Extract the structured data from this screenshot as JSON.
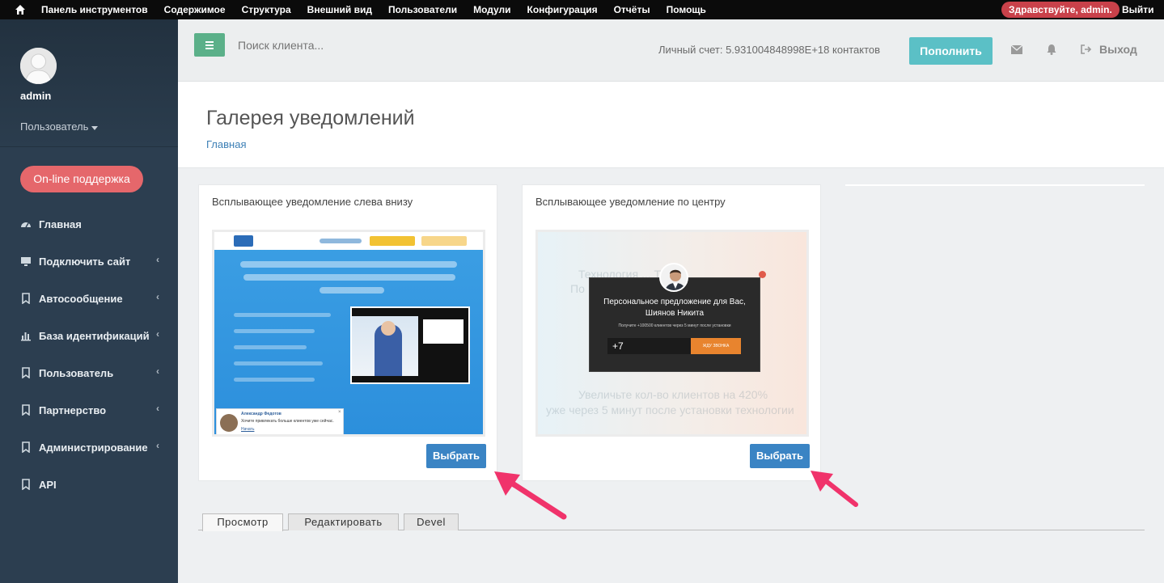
{
  "adminbar": {
    "menu": [
      "Панель инструментов",
      "Содержимое",
      "Структура",
      "Внешний вид",
      "Пользователи",
      "Модули",
      "Конфигурация",
      "Отчёты",
      "Помощь"
    ],
    "greeting": "Здравствуйте, admin.",
    "logout": "Выйти",
    "greeting_color": "#c9414a"
  },
  "sidebar": {
    "username": "admin",
    "role": "Пользователь",
    "support_button": "On-line поддержка",
    "items": [
      {
        "label": "Главная",
        "icon": "dashboard-icon",
        "has_submenu": false
      },
      {
        "label": "Подключить сайт",
        "icon": "monitor-icon",
        "has_submenu": true
      },
      {
        "label": "Автосообщение",
        "icon": "bookmark-icon",
        "has_submenu": true
      },
      {
        "label": "База идентификаций",
        "icon": "bar-chart-icon",
        "has_submenu": true
      },
      {
        "label": "Пользователь",
        "icon": "bookmark-icon",
        "has_submenu": true
      },
      {
        "label": "Партнерство",
        "icon": "bookmark-icon",
        "has_submenu": true
      },
      {
        "label": "Администрирование",
        "icon": "bookmark-icon",
        "has_submenu": true
      },
      {
        "label": "API",
        "icon": "bookmark-icon",
        "has_submenu": false
      }
    ],
    "bg_color": "#2c3e50",
    "support_color": "#e5676b"
  },
  "header": {
    "search_placeholder": "Поиск клиента...",
    "account_text": "Личный счет: 5.931004848998E+18 контактов",
    "topup_button": "Пополнить",
    "logout_button": "Выход",
    "menu_button_color": "#5bb089",
    "topup_color": "#5bc0c6"
  },
  "page": {
    "title": "Галерея уведомлений",
    "breadcrumb": "Главная"
  },
  "cards": [
    {
      "title": "Всплывающее уведомление слева внизу",
      "select_button": "Выбрать",
      "preview": {
        "notice_name": "Александр Федотов",
        "notice_message": "Хочите привлекать больше клиентов уже сейчас.",
        "notice_link": "Начать"
      }
    },
    {
      "title": "Всплывающее уведомление по центру",
      "select_button": "Выбрать",
      "preview": {
        "offer_line1": "Персональное предложение для Вас,",
        "offer_line2": "Шиянов Никита",
        "fine_print": "Получите +100500 клиентов через 5 минут после установки",
        "phone_value": "+7",
        "call_button": "ЖДУ ЗВОНКА",
        "bg_text_1": "Увеличьте кол-во клиентов на 420%",
        "bg_text_2": "уже через 5 минут после установки технологии"
      }
    }
  ],
  "select_button_color": "#3a84c4",
  "arrow_color": "#f0336b",
  "tabs": [
    {
      "label": "Просмотр",
      "active": true
    },
    {
      "label": "Редактировать",
      "active": false
    },
    {
      "label": "Devel",
      "active": false
    }
  ]
}
